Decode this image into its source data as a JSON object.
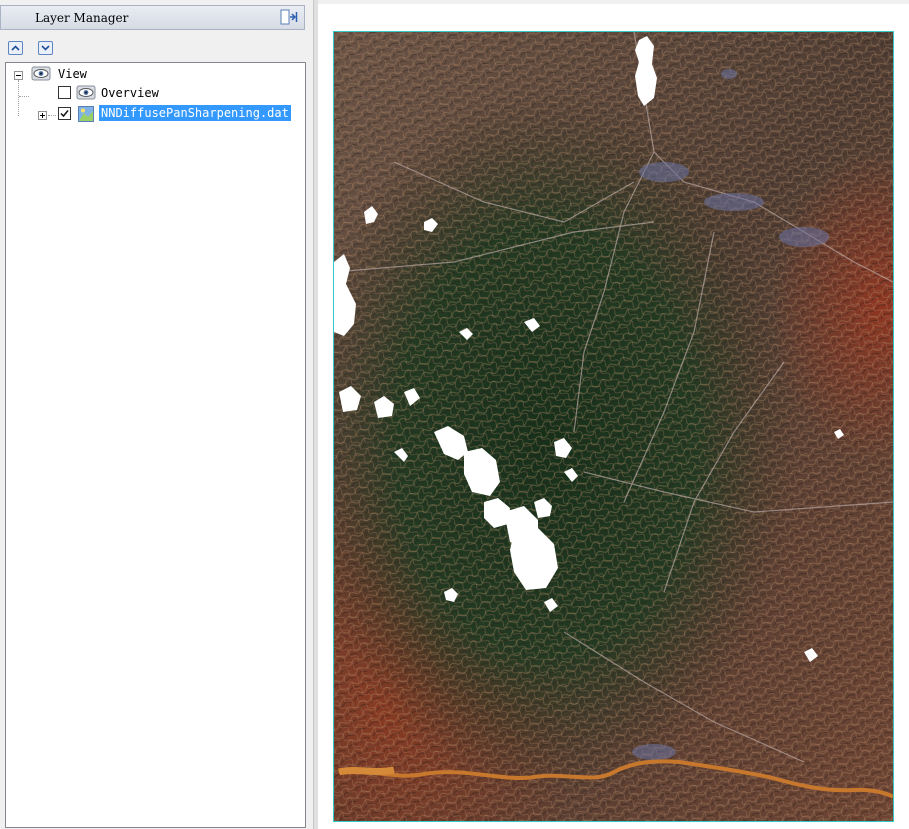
{
  "layer_manager": {
    "title": "Layer Manager",
    "toolbar": {
      "move_up_icon": "chevron-up-icon",
      "move_down_icon": "chevron-down-icon",
      "pin_icon": "pin-panel-icon"
    },
    "tree": {
      "root": {
        "label": "View",
        "expanded": true,
        "icon": "eye-icon"
      },
      "children": [
        {
          "label": "Overview",
          "checked": false,
          "icon": "eye-icon",
          "selected": false
        },
        {
          "label": "NNDiffusePanSharpening.dat",
          "checked": true,
          "icon": "raster-image-icon",
          "selected": true,
          "expandable": true
        }
      ]
    }
  },
  "view": {
    "content": "satellite-imagery",
    "frame_color": "#33c9c9"
  },
  "colors": {
    "selection": "#3399ff",
    "panel_bg": "#f0f0f0"
  }
}
